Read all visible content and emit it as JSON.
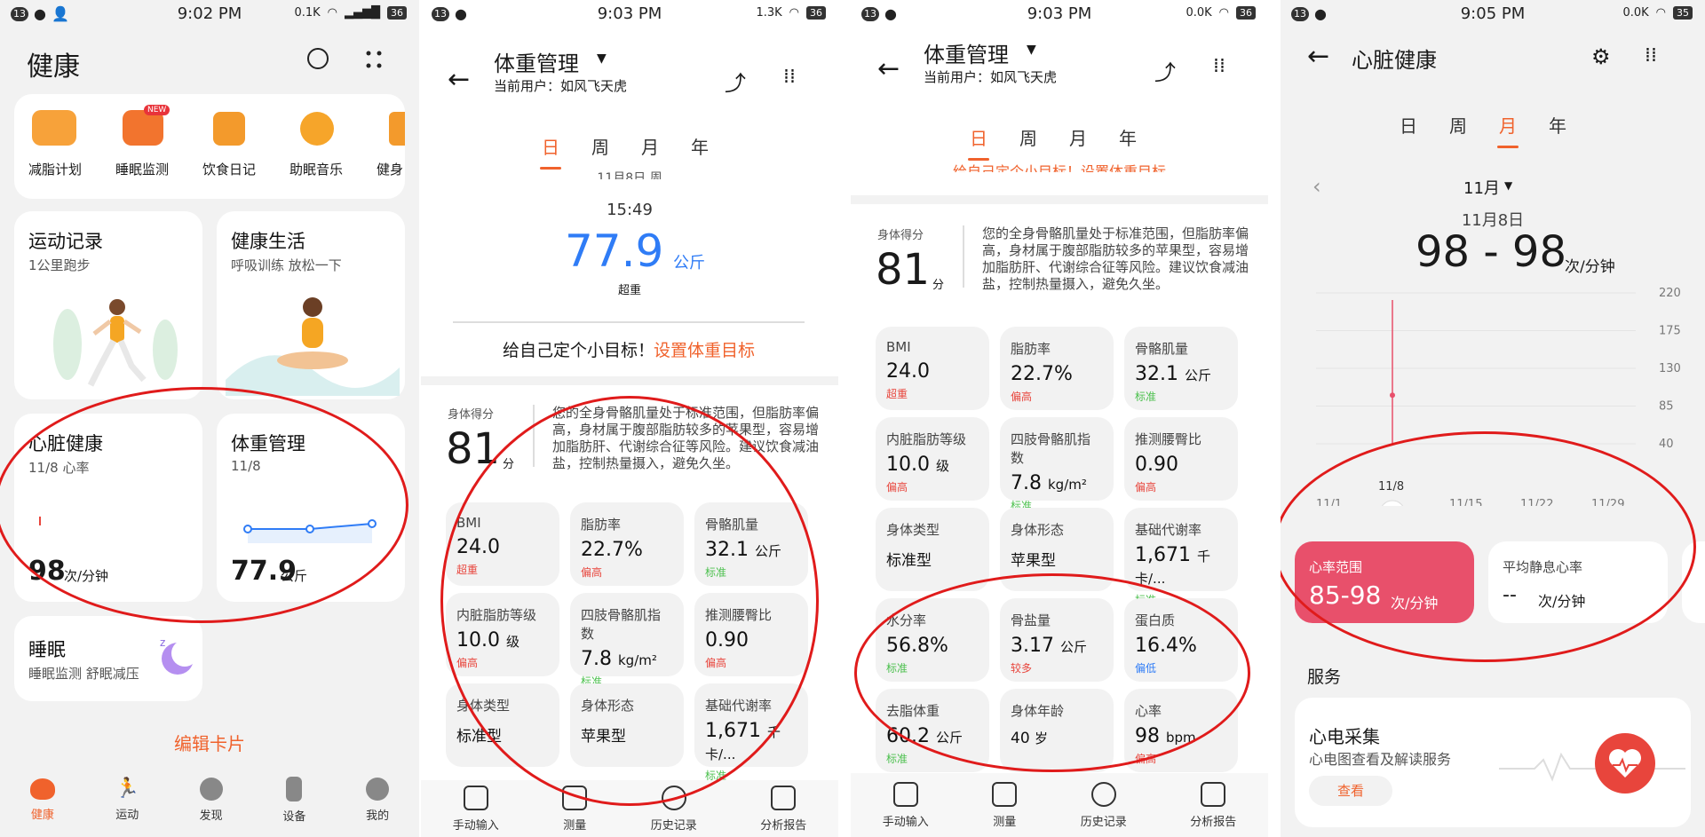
{
  "status": [
    {
      "badge": "13",
      "time": "9:02 PM",
      "speed": "0.1K",
      "battery": "36"
    },
    {
      "badge": "13",
      "time": "9:03 PM",
      "speed": "1.3K",
      "battery": "36"
    },
    {
      "badge": "13",
      "time": "9:03 PM",
      "speed": "0.0K",
      "battery": "36"
    },
    {
      "badge": "13",
      "time": "9:05 PM",
      "speed": "0.0K",
      "battery": "35"
    }
  ],
  "health_home": {
    "title": "健康",
    "shortcuts": [
      "减脂计划",
      "睡眠监测",
      "饮食日记",
      "助眠音乐",
      "健身"
    ],
    "new_badge": "NEW",
    "cards": {
      "exercise": {
        "title": "运动记录",
        "sub": "1公里跑步"
      },
      "life": {
        "title": "健康生活",
        "sub": "呼吸训练 放松一下"
      },
      "heart": {
        "title": "心脏健康",
        "sub": "11/8 心率",
        "value": "98",
        "unit": "次/分钟"
      },
      "weight": {
        "title": "体重管理",
        "sub": "11/8",
        "value": "77.9",
        "unit": "公斤",
        "trend": [
          0.3,
          0.3,
          0.6
        ]
      },
      "sleep": {
        "title": "睡眠",
        "sub": "睡眠监测 舒眠减压"
      }
    },
    "edit": "编辑卡片",
    "nav": [
      "健康",
      "运动",
      "发现",
      "设备",
      "我的"
    ]
  },
  "weight": {
    "title": "体重管理",
    "user": "当前用户：如风飞天虎",
    "tabs": [
      "日",
      "周",
      "月",
      "年"
    ],
    "date_partial": "11月8日 周",
    "time": "15:49",
    "weight": "77.9",
    "unit": "公斤",
    "status": "超重",
    "goal_text": "给自己定个小目标！",
    "goal_link": "设置体重目标",
    "score_label": "身体得分",
    "score": "81",
    "score_unit": "分",
    "summary": "您的全身骨骼肌量处于标准范围，但脂肪率偏高，身材属于腹部脂肪较多的苹果型，容易增加脂肪肝、代谢综合征等风险。建议饮食减油盐，控制热量摄入，避免久坐。",
    "metrics": [
      {
        "label": "BMI",
        "value": "24.0",
        "unit": "",
        "status": "超重",
        "color": "red"
      },
      {
        "label": "脂肪率",
        "value": "22.7%",
        "unit": "",
        "status": "偏高",
        "color": "red"
      },
      {
        "label": "骨骼肌量",
        "value": "32.1",
        "unit": "公斤",
        "status": "标准",
        "color": "green"
      },
      {
        "label": "内脏脂肪等级",
        "value": "10.0",
        "unit": "级",
        "status": "偏高",
        "color": "red"
      },
      {
        "label": "四肢骨骼肌指数",
        "value": "7.8",
        "unit": "kg/m²",
        "status": "标准",
        "color": "green"
      },
      {
        "label": "推测腰臀比",
        "value": "0.90",
        "unit": "",
        "status": "偏高",
        "color": "red"
      },
      {
        "label": "身体类型",
        "value": "标准型",
        "unit": "",
        "status": "",
        "color": "green"
      },
      {
        "label": "身体形态",
        "value": "苹果型",
        "unit": "",
        "status": "",
        "color": "green"
      },
      {
        "label": "基础代谢率",
        "value": "1,671",
        "unit": "千卡/...",
        "status": "标准",
        "color": "green"
      },
      {
        "label": "水分率",
        "value": "56.8%",
        "unit": "",
        "status": "标准",
        "color": "green"
      },
      {
        "label": "骨盐量",
        "value": "3.17",
        "unit": "公斤",
        "status": "较多",
        "color": "red"
      },
      {
        "label": "蛋白质",
        "value": "16.4%",
        "unit": "",
        "status": "偏低",
        "color": "blue"
      },
      {
        "label": "去脂体重",
        "value": "60.2",
        "unit": "公斤",
        "status": "标准",
        "color": "green"
      },
      {
        "label": "身体年龄",
        "value": "40",
        "unit": "岁",
        "status": "",
        "color": "green"
      },
      {
        "label": "心率",
        "value": "98",
        "unit": "bpm",
        "status": "偏高",
        "color": "red"
      }
    ],
    "toolbar": [
      "手动输入",
      "测量",
      "历史记录",
      "分析报告"
    ],
    "partial_goal": "给自己定个小目标！设置体重目标"
  },
  "heart": {
    "title": "心脏健康",
    "tabs": [
      "日",
      "周",
      "月",
      "年"
    ],
    "month": "11月",
    "date": "11月8日",
    "range": "98 - 98",
    "range_unit": "次/分钟",
    "y_ticks": [
      "220",
      "175",
      "130",
      "85",
      "40"
    ],
    "x_ticks": [
      "11/1",
      "11/8",
      "11/15",
      "11/22",
      "11/29"
    ],
    "chart_data": {
      "type": "scatter",
      "x": [
        "11/8"
      ],
      "y": [
        98
      ],
      "ylim": [
        40,
        220
      ],
      "title": "",
      "xlabel": "",
      "ylabel": ""
    },
    "range_card": {
      "label": "心率范围",
      "value": "85-98",
      "unit": "次/分钟"
    },
    "resting_card": {
      "label": "平均静息心率",
      "value": "--",
      "unit": "次/分钟"
    },
    "services_title": "服务",
    "ecg": {
      "title": "心电采集",
      "sub": "心电图查看及解读服务",
      "button": "查看"
    }
  }
}
